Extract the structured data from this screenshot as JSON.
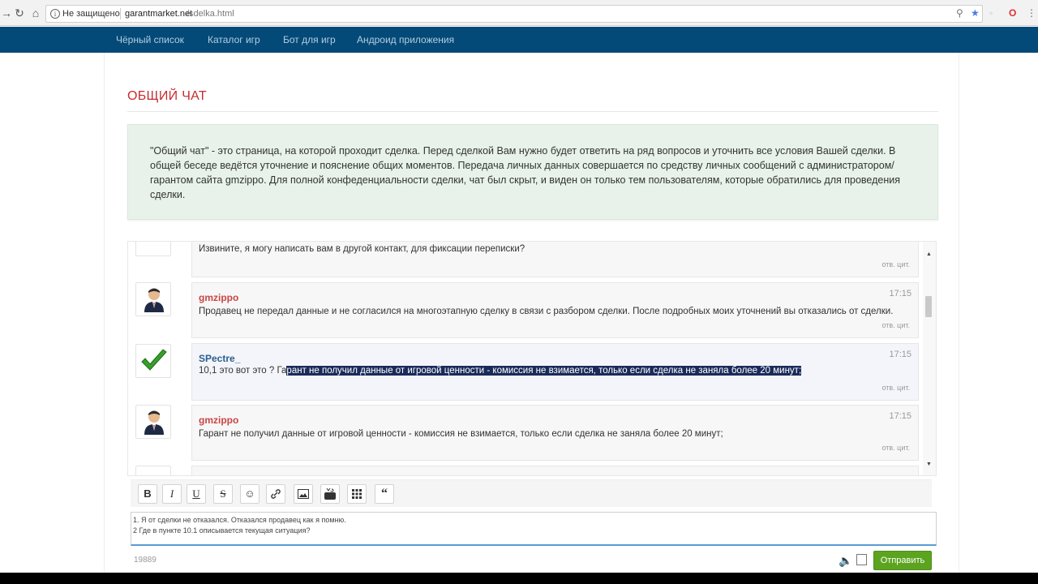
{
  "browser": {
    "insecure_label": "Не защищено",
    "url_domain": "garantmarket.net",
    "url_path": "/sdelka.html"
  },
  "nav": {
    "items": [
      "Чёрный список",
      "Каталог игр",
      "Бот для игр",
      "Андроид приложения"
    ]
  },
  "page": {
    "title": "ОБЩИЙ ЧАТ",
    "info": "\"Общий чат\" - это страница, на которой проходит сделка. Перед сделкой Вам нужно будет ответить на ряд вопросов и уточнить все условия Вашей сделки. В общей беседе ведётся уточнение и пояснение общих моментов. Передача личных данных совершается по средству личных сообщений с администратором/гарантом сайта gmzippo. Для полной конфеденциальности сделки, чат был скрыт, и виден он только тем пользователям, которые обратились для проведения сделки."
  },
  "chat": {
    "messages": [
      {
        "text": "Извините, я могу написать вам в другой контакт, для фиксации переписки?",
        "actions": "отв. цит."
      },
      {
        "user": "gmzippo",
        "time": "17:15",
        "text": "Продавец не передал данные и не согласился на многоэтапную сделку в связи с разбором сделки. После подробных моих уточнений вы отказались от сделки.",
        "actions": "отв. цит."
      },
      {
        "user": "SPectre_",
        "time": "17:15",
        "text_before": "10,1 это вот это ? Га",
        "text_highlight": "рант не получил данные от игровой ценности - комиссия не взимается, только если сделка не заняла более 20 минут;",
        "actions": "отв. цит."
      },
      {
        "user": "gmzippo",
        "time": "17:15",
        "text": "Гарант не получил данные от игровой ценности - комиссия не взимается, только если сделка не заняла более 20 минут;",
        "actions": "отв. цит."
      }
    ]
  },
  "editor": {
    "toolbar": [
      "B",
      "I",
      "U",
      "S"
    ],
    "lines": [
      "1. Я от сделки не отказался. Отказался продавец как я помню.",
      "2 Где в пункте 10.1 описывается текущая ситуация?"
    ],
    "char_count": "19889",
    "send_label": "Отправить"
  },
  "colors": {
    "nav_bg": "#034a78",
    "title": "#c52d2f",
    "info_bg": "#e8f2ea",
    "send_bg": "#5ca320",
    "highlight": "#1a2b5a"
  }
}
